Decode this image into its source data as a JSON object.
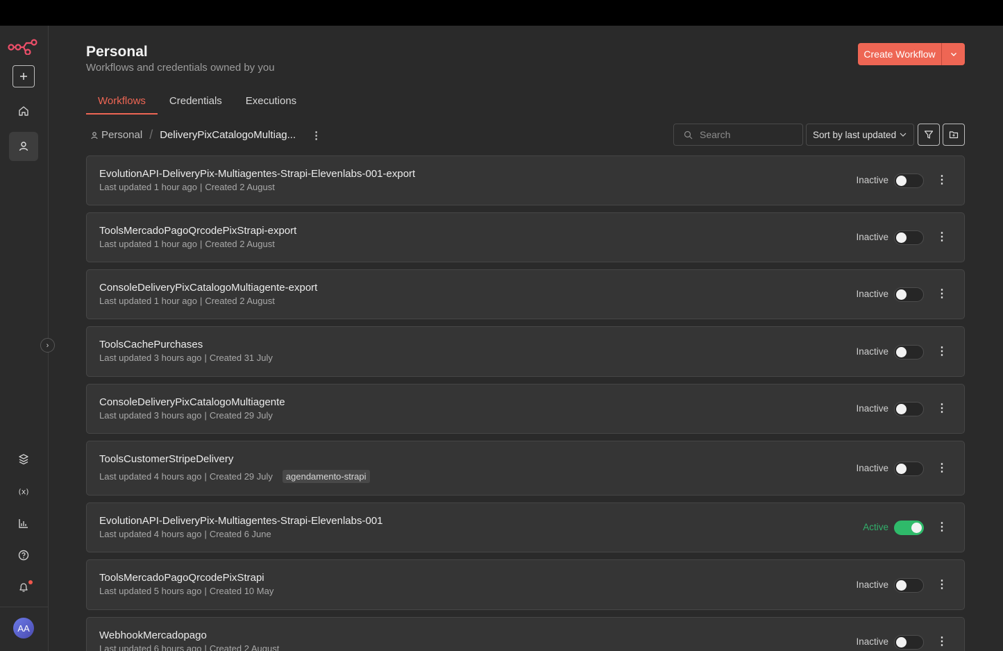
{
  "page": {
    "title": "Personal",
    "subtitle": "Workflows and credentials owned by you",
    "create_label": "Create Workflow"
  },
  "tabs": [
    {
      "label": "Workflows",
      "active": true
    },
    {
      "label": "Credentials",
      "active": false
    },
    {
      "label": "Executions",
      "active": false
    }
  ],
  "breadcrumb": {
    "root": "Personal",
    "current": "DeliveryPixCatalogoMultiag..."
  },
  "toolbar": {
    "search_placeholder": "Search",
    "sort_label": "Sort by last updated"
  },
  "sidebar": {
    "avatar_initials": "AA",
    "icons": [
      "add-icon",
      "home-icon",
      "user-icon",
      "templates-icon",
      "variables-icon",
      "insights-icon",
      "help-icon",
      "bell-icon"
    ]
  },
  "colors": {
    "accent": "#ee6654",
    "active_green": "#2fba6a",
    "background": "#2a2a2a",
    "card": "#353535"
  },
  "workflows": [
    {
      "name": "EvolutionAPI-DeliveryPix-Multiagentes-Strapi-Elevenlabs-001-export",
      "updated": "Last updated 1 hour ago",
      "created": "Created 2 August",
      "tag": "",
      "status": "Inactive",
      "active": false
    },
    {
      "name": "ToolsMercadoPagoQrcodePixStrapi-export",
      "updated": "Last updated 1 hour ago",
      "created": "Created 2 August",
      "tag": "",
      "status": "Inactive",
      "active": false
    },
    {
      "name": "ConsoleDeliveryPixCatalogoMultiagente-export",
      "updated": "Last updated 1 hour ago",
      "created": "Created 2 August",
      "tag": "",
      "status": "Inactive",
      "active": false
    },
    {
      "name": "ToolsCachePurchases",
      "updated": "Last updated 3 hours ago",
      "created": "Created 31 July",
      "tag": "",
      "status": "Inactive",
      "active": false
    },
    {
      "name": "ConsoleDeliveryPixCatalogoMultiagente",
      "updated": "Last updated 3 hours ago",
      "created": "Created 29 July",
      "tag": "",
      "status": "Inactive",
      "active": false
    },
    {
      "name": "ToolsCustomerStripeDelivery",
      "updated": "Last updated 4 hours ago",
      "created": "Created 29 July",
      "tag": "agendamento-strapi",
      "status": "Inactive",
      "active": false
    },
    {
      "name": "EvolutionAPI-DeliveryPix-Multiagentes-Strapi-Elevenlabs-001",
      "updated": "Last updated 4 hours ago",
      "created": "Created 6 June",
      "tag": "",
      "status": "Active",
      "active": true
    },
    {
      "name": "ToolsMercadoPagoQrcodePixStrapi",
      "updated": "Last updated 5 hours ago",
      "created": "Created 10 May",
      "tag": "",
      "status": "Inactive",
      "active": false
    },
    {
      "name": "WebhookMercadopago",
      "updated": "Last updated 6 hours ago",
      "created": "Created 2 August",
      "tag": "",
      "status": "Inactive",
      "active": false
    }
  ]
}
